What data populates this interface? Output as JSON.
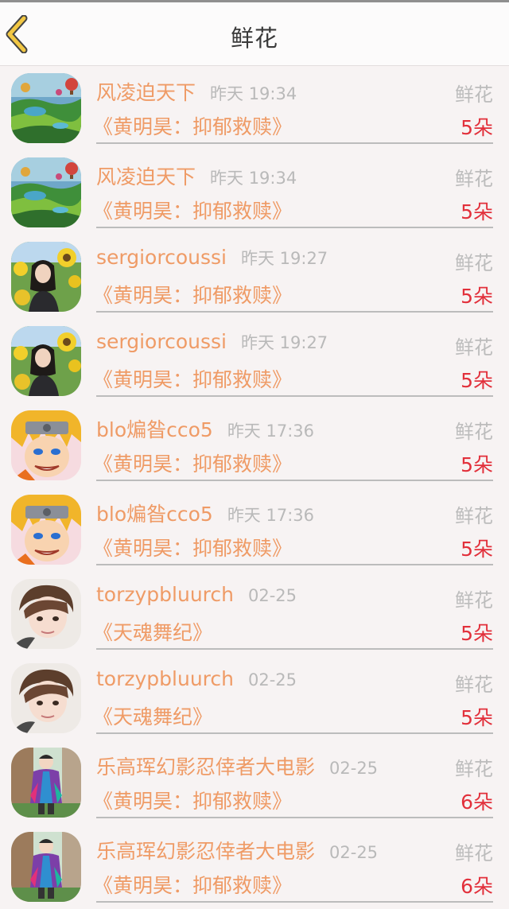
{
  "header": {
    "title": "鲜花"
  },
  "items": [
    {
      "user": "风凌迫天下",
      "time": "昨天 19:34",
      "type": "鲜花",
      "book": "《黄明昊：抑郁救赎》",
      "count": "5朵",
      "avatar": "landscape"
    },
    {
      "user": "风凌迫天下",
      "time": "昨天 19:34",
      "type": "鲜花",
      "book": "《黄明昊：抑郁救赎》",
      "count": "5朵",
      "avatar": "landscape"
    },
    {
      "user": "sergiorcoussi",
      "time": "昨天 19:27",
      "type": "鲜花",
      "book": "《黄明昊：抑郁救赎》",
      "count": "5朵",
      "avatar": "sunflower"
    },
    {
      "user": "sergiorcoussi",
      "time": "昨天 19:27",
      "type": "鲜花",
      "book": "《黄明昊：抑郁救赎》",
      "count": "5朵",
      "avatar": "sunflower"
    },
    {
      "user": "blo煸昝cco5",
      "time": "昨天 17:36",
      "type": "鲜花",
      "book": "《黄明昊：抑郁救赎》",
      "count": "5朵",
      "avatar": "anime"
    },
    {
      "user": "blo煸昝cco5",
      "time": "昨天 17:36",
      "type": "鲜花",
      "book": "《黄明昊：抑郁救赎》",
      "count": "5朵",
      "avatar": "anime"
    },
    {
      "user": "torzypbluurch",
      "time": "02-25",
      "type": "鲜花",
      "book": "《天魂舞纪》",
      "count": "5朵",
      "avatar": "portrait"
    },
    {
      "user": "torzypbluurch",
      "time": "02-25",
      "type": "鲜花",
      "book": "《天魂舞纪》",
      "count": "5朵",
      "avatar": "portrait"
    },
    {
      "user": "乐高珲幻影忍倖者大电影",
      "time": "02-25",
      "type": "鲜花",
      "book": "《黄明昊：抑郁救赎》",
      "count": "6朵",
      "avatar": "street"
    },
    {
      "user": "乐高珲幻影忍倖者大电影",
      "time": "02-25",
      "type": "鲜花",
      "book": "《黄明昊：抑郁救赎》",
      "count": "6朵",
      "avatar": "street"
    }
  ]
}
